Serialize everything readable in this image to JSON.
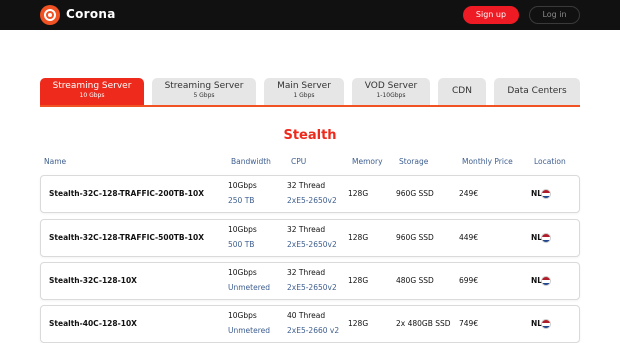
{
  "header": {
    "brand": "Corona",
    "signup_label": "Sign up",
    "login_label": "Log in"
  },
  "tabs": [
    {
      "title": "Streaming Server",
      "sub": "10 Gbps",
      "active": true
    },
    {
      "title": "Streaming Server",
      "sub": "5 Gbps",
      "active": false
    },
    {
      "title": "Main Server",
      "sub": "1 Gbps",
      "active": false
    },
    {
      "title": "VOD Server",
      "sub": "1-10Gbps",
      "active": false
    },
    {
      "title": "CDN",
      "sub": "",
      "active": false
    },
    {
      "title": "Data Centers",
      "sub": "",
      "active": false
    }
  ],
  "section_title": "Stealth",
  "table": {
    "columns": [
      "Name",
      "Bandwidth",
      "CPU",
      "Memory",
      "Storage",
      "Monthly Price",
      "Location"
    ],
    "rows": [
      {
        "name": "Stealth-32C-128-TRAFFIC-200TB-10X",
        "bandwidth": "10Gbps",
        "traffic": "250 TB",
        "cpu": "32 Thread",
        "cpu_model": "2xE5-2650v2",
        "memory": "128G",
        "storage": "960G SSD",
        "price": "249€",
        "location": "NL"
      },
      {
        "name": "Stealth-32C-128-TRAFFIC-500TB-10X",
        "bandwidth": "10Gbps",
        "traffic": "500 TB",
        "cpu": "32 Thread",
        "cpu_model": "2xE5-2650v2",
        "memory": "128G",
        "storage": "960G SSD",
        "price": "449€",
        "location": "NL"
      },
      {
        "name": "Stealth-32C-128-10X",
        "bandwidth": "10Gbps",
        "traffic": "Unmetered",
        "cpu": "32 Thread",
        "cpu_model": "2xE5-2650v2",
        "memory": "128G",
        "storage": "480G SSD",
        "price": "699€",
        "location": "NL"
      },
      {
        "name": "Stealth-40C-128-10X",
        "bandwidth": "10Gbps",
        "traffic": "Unmetered",
        "cpu": "40 Thread",
        "cpu_model": "2xE5-2660 v2",
        "memory": "128G",
        "storage": "2x 480GB SSD",
        "price": "749€",
        "location": "NL"
      }
    ]
  },
  "colors": {
    "accent": "#ee2a1c",
    "topbar": "#111111",
    "header_text": "#3e5e8f"
  }
}
